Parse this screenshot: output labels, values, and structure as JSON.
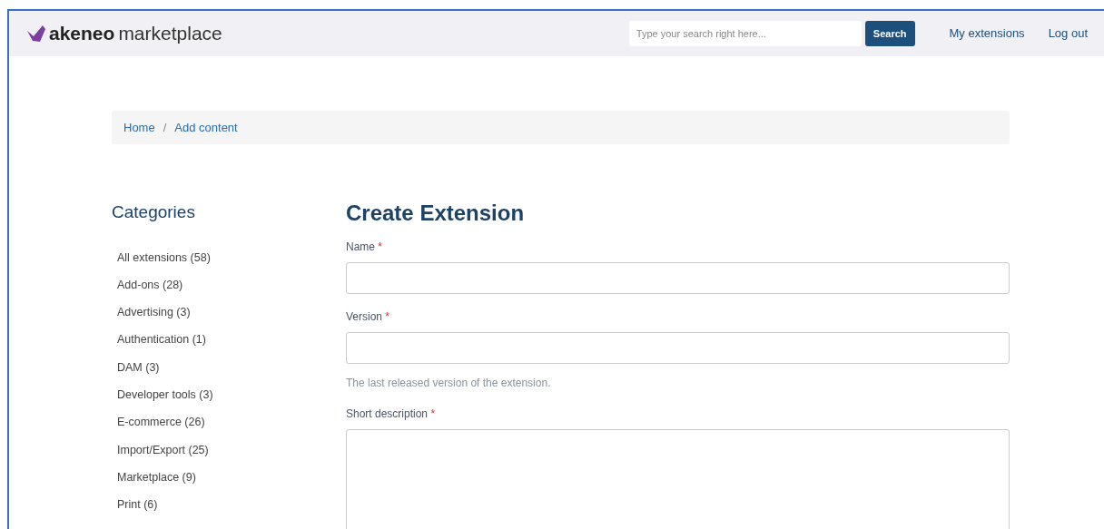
{
  "header": {
    "brand_bold": "akeneo",
    "brand_light": "marketplace",
    "search": {
      "placeholder": "Type your search right here..."
    },
    "search_button": "Search",
    "links": [
      "My extensions",
      "Log out"
    ]
  },
  "breadcrumb": [
    {
      "label": "Home"
    },
    {
      "label": "Add content"
    }
  ],
  "breadcrumb_separator": "/",
  "sidebar": {
    "title": "Categories",
    "items": [
      {
        "label": "All extensions (58)"
      },
      {
        "label": "Add-ons (28)"
      },
      {
        "label": "Advertising (3)"
      },
      {
        "label": "Authentication (1)"
      },
      {
        "label": "DAM (3)"
      },
      {
        "label": "Developer tools (3)"
      },
      {
        "label": "E-commerce (26)"
      },
      {
        "label": "Import/Export (25)"
      },
      {
        "label": "Marketplace (9)"
      },
      {
        "label": "Print (6)"
      }
    ]
  },
  "form": {
    "title": "Create Extension",
    "fields": [
      {
        "label": "Name",
        "required_mark": "*",
        "kind": "text"
      },
      {
        "label": "Version",
        "required_mark": "*",
        "kind": "text",
        "help": "The last released version of the extension."
      },
      {
        "label": "Short description",
        "required_mark": "*",
        "kind": "textarea"
      }
    ]
  }
}
